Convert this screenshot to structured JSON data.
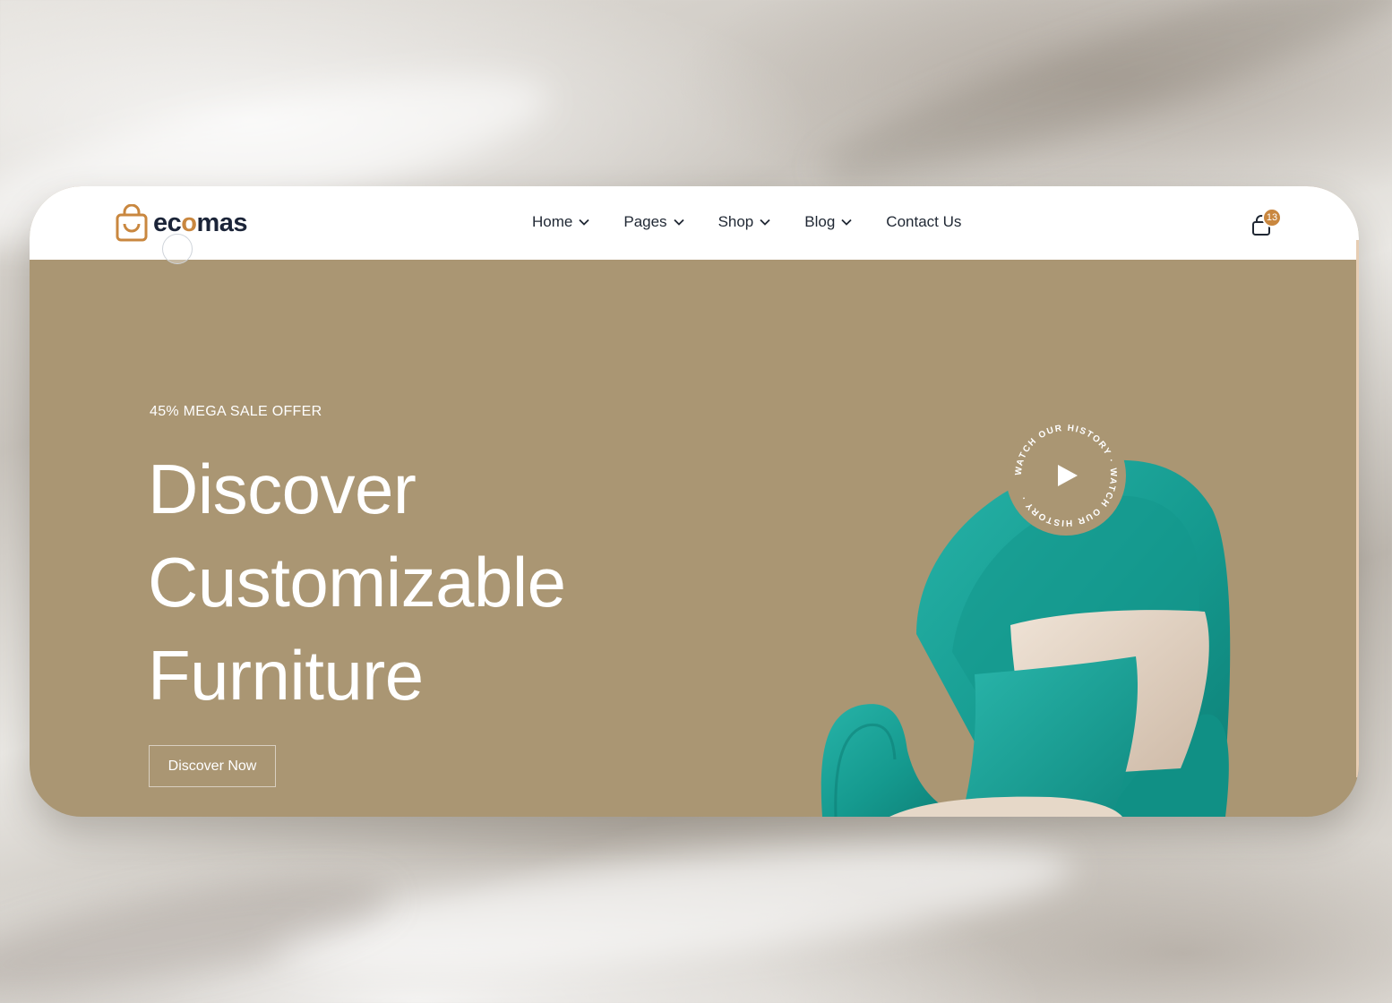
{
  "brand": {
    "name_prefix": "ec",
    "name_highlight": "o",
    "name_suffix": "mas",
    "logo_icon": "shopping-bag-icon"
  },
  "nav": {
    "items": [
      {
        "label": "Home",
        "has_dropdown": true
      },
      {
        "label": "Pages",
        "has_dropdown": true
      },
      {
        "label": "Shop",
        "has_dropdown": true
      },
      {
        "label": "Blog",
        "has_dropdown": true
      },
      {
        "label": "Contact Us",
        "has_dropdown": false
      }
    ]
  },
  "cart": {
    "icon": "shopping-bag-icon",
    "count": "13"
  },
  "hero": {
    "eyebrow": "45% MEGA SALE OFFER",
    "headline_lines": [
      "Discover",
      "Customizable",
      "Furniture"
    ],
    "cta_label": "Discover Now",
    "video_badge_text": "WATCH OUR HISTORY · WATCH OUR HISTORY ·",
    "play_icon": "play-icon"
  },
  "colors": {
    "hero_bg": "#aa9673",
    "accent": "#c9873f",
    "nav_text": "#1f2733",
    "chair": "#1ba197"
  }
}
